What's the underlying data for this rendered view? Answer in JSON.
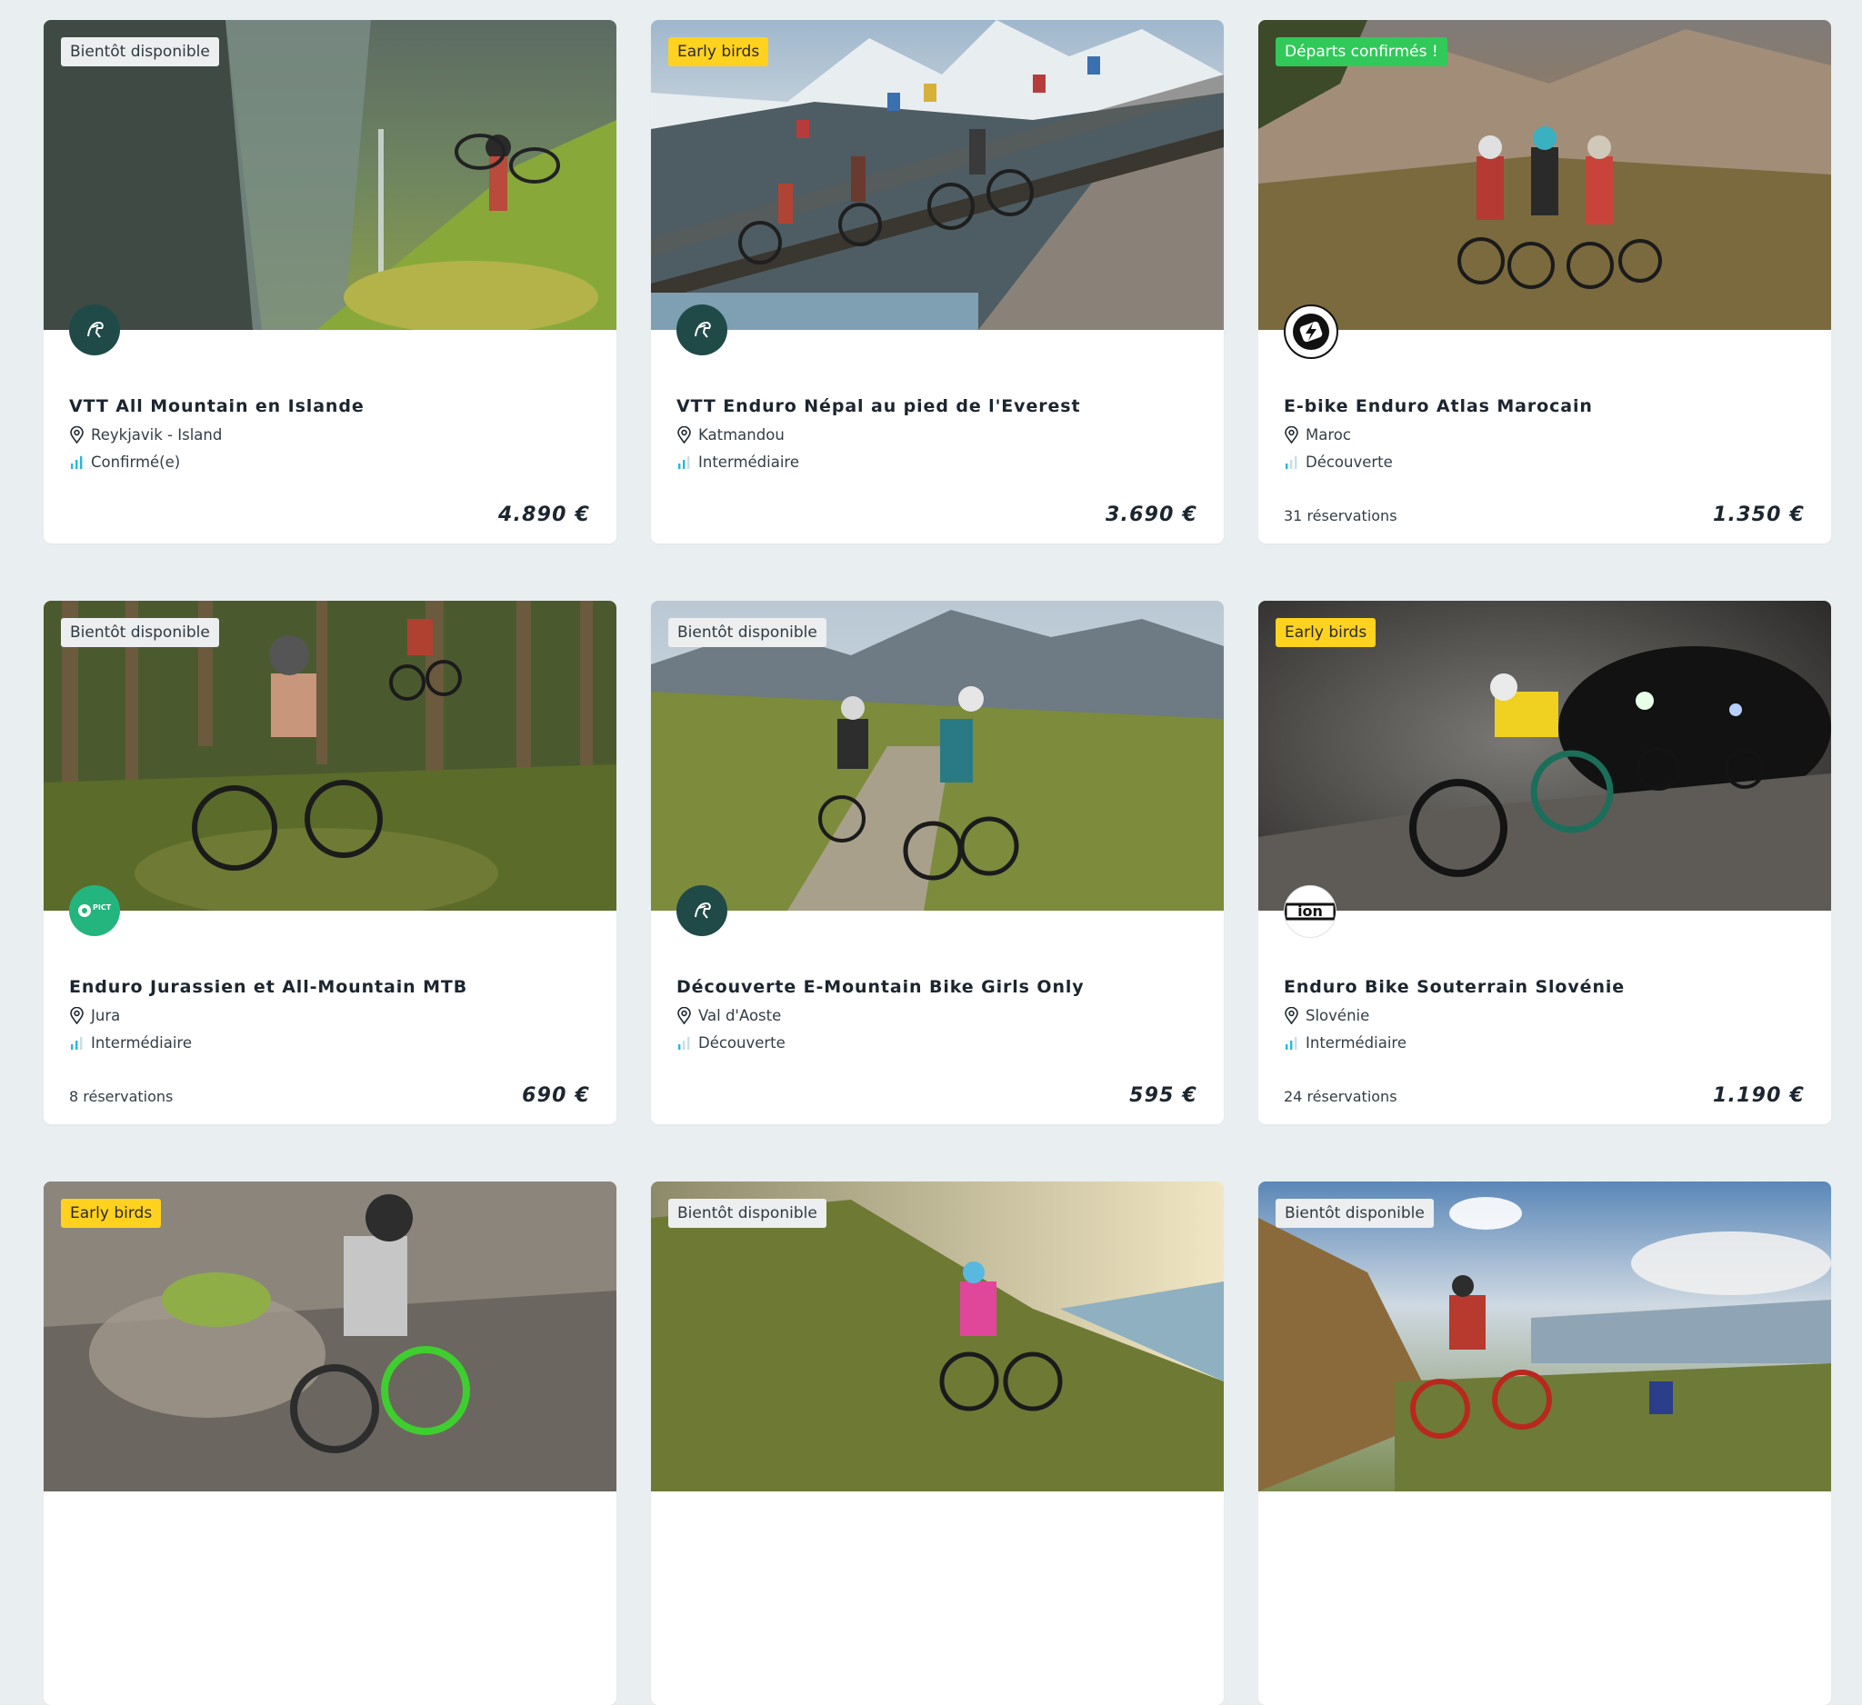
{
  "cards": [
    {
      "badge": "Bientôt disponible",
      "badge_color": "#eceeef",
      "title": "VTT All Mountain en Islande",
      "location": "Reykjavik - Island",
      "level": "Confirmé(e)",
      "reservations": "",
      "price": "4.890 €",
      "logo": "climber-logo-icon"
    },
    {
      "badge": "Early birds",
      "badge_color": "#ffd21f",
      "title": "VTT Enduro Népal au pied de l'Everest",
      "location": "Katmandou",
      "level": "Intermédiaire",
      "reservations": "",
      "price": "3.690 €",
      "logo": "climber-logo-icon"
    },
    {
      "badge": "Départs confirmés !",
      "badge_color": "#31c95a",
      "title": "E-bike Enduro Atlas Marocain",
      "location": "Maroc",
      "level": "Découverte",
      "reservations": "31 réservations",
      "price": "1.350 €",
      "logo": "lightning-logo-icon"
    },
    {
      "badge": "Bientôt disponible",
      "badge_color": "#eceeef",
      "title": "Enduro Jurassien et All-Mountain MTB",
      "location": "Jura",
      "level": "Intermédiaire",
      "reservations": "8 réservations",
      "price": "690 €",
      "logo": "picture-brand-logo-icon",
      "logo_text": "PICT URE"
    },
    {
      "badge": "Bientôt disponible",
      "badge_color": "#eceeef",
      "title": "Découverte E-Mountain Bike Girls Only",
      "location": "Val d'Aoste",
      "level": "Découverte",
      "reservations": "",
      "price": "595 €",
      "logo": "climber-logo-icon"
    },
    {
      "badge": "Early birds",
      "badge_color": "#ffd21f",
      "title": "Enduro Bike Souterrain Slovénie",
      "location": "Slovénie",
      "level": "Intermédiaire",
      "reservations": "24 réservations",
      "price": "1.190 €",
      "logo": "ion-logo-icon",
      "logo_text": "ion"
    },
    {
      "badge": "Early birds",
      "badge_color": "#ffd21f"
    },
    {
      "badge": "Bientôt disponible",
      "badge_color": "#eceeef"
    },
    {
      "badge": "Bientôt disponible",
      "badge_color": "#eceeef"
    }
  ]
}
